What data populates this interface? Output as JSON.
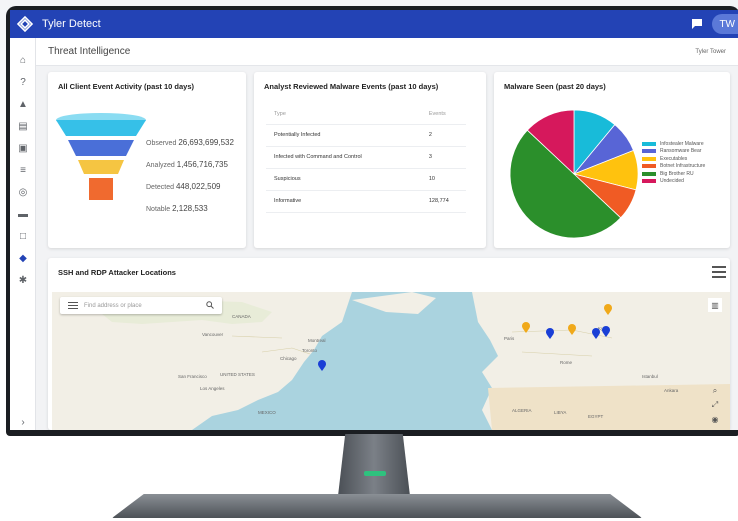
{
  "app": {
    "title": "Tyler Detect",
    "avatar_initials": "TW"
  },
  "header": {
    "title": "Threat Intelligence",
    "user": "Tyler Tower"
  },
  "sidebar": {
    "items": [
      {
        "name": "home-icon",
        "glyph": "⌂"
      },
      {
        "name": "help-icon",
        "glyph": "?"
      },
      {
        "name": "alert-icon",
        "glyph": "▲"
      },
      {
        "name": "document-icon",
        "glyph": "▤"
      },
      {
        "name": "calendar-icon",
        "glyph": "▣"
      },
      {
        "name": "list-icon",
        "glyph": "≡"
      },
      {
        "name": "globe-icon",
        "glyph": "◎"
      },
      {
        "name": "folder-icon",
        "glyph": "▬"
      },
      {
        "name": "box-icon",
        "glyph": "□"
      },
      {
        "name": "shield-icon",
        "glyph": "◆",
        "active": true
      },
      {
        "name": "gear-icon",
        "glyph": "✱"
      }
    ],
    "expand_glyph": "›"
  },
  "funnel": {
    "title": "All Client Event Activity (past 10 days)",
    "rows": [
      {
        "label": "Observed",
        "value": "26,693,699,532"
      },
      {
        "label": "Analyzed",
        "value": "1,456,716,735"
      },
      {
        "label": "Detected",
        "value": "448,022,509"
      },
      {
        "label": "Notable",
        "value": "2,128,533"
      }
    ],
    "colors": [
      "#36c0e8",
      "#4a6fd8",
      "#f5c542",
      "#f06a2f"
    ]
  },
  "malware_table": {
    "title": "Analyst Reviewed Malware Events (past 10 days)",
    "headers": [
      "Type",
      "Events"
    ],
    "rows": [
      [
        "Potentially Infected",
        "2"
      ],
      [
        "Infected with Command and Control",
        "3"
      ],
      [
        "Suspicious",
        "10"
      ],
      [
        "Informative",
        "128,774"
      ]
    ]
  },
  "malware_seen": {
    "title": "Malware Seen (past 20 days)",
    "legend": [
      "Infostealer Malware",
      "Ransomware Bear",
      "Executables",
      "Botnet Infrastructure",
      "Big Brother RU",
      "Undecided"
    ],
    "chart_data": {
      "type": "pie",
      "values": [
        11,
        8,
        10,
        8,
        50,
        13
      ],
      "colors": [
        "#18bbd9",
        "#5865d6",
        "#ffc20e",
        "#f05b24",
        "#2b8f2b",
        "#d6185c"
      ]
    }
  },
  "map_card": {
    "title": "SSH and RDP Attacker Locations",
    "search_placeholder": "Find address or place",
    "labels": [
      "CANADA",
      "Vancouver",
      "Montreal",
      "Toronto",
      "Chicago",
      "UNITED STATES",
      "San Francisco",
      "Los Angeles",
      "MEXICO",
      "Paris",
      "Rome",
      "Kyiv",
      "ALGERIA",
      "LIBYA",
      "EGYPT",
      "Istanbul",
      "Ankara"
    ]
  }
}
